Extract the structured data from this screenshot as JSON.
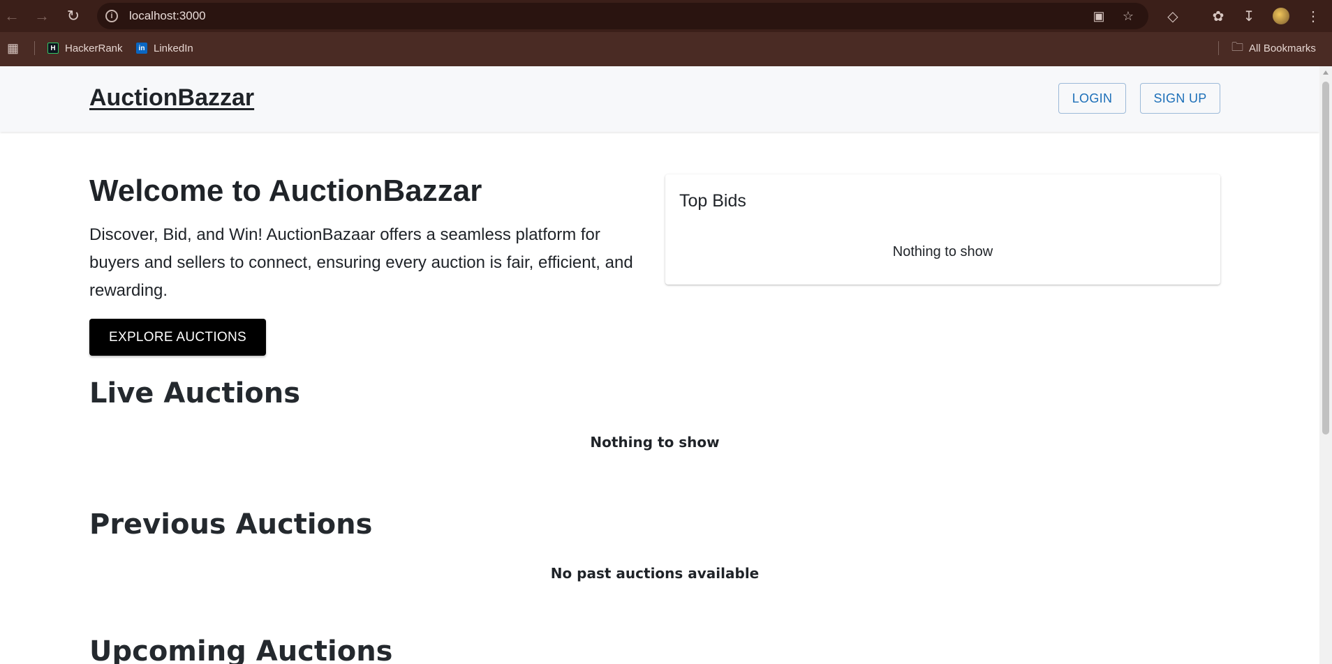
{
  "browser": {
    "url": "localhost:3000",
    "bookmarks": [
      {
        "label": "HackerRank",
        "icon": "hackerrank-icon"
      },
      {
        "label": "LinkedIn",
        "icon": "linkedin-icon"
      }
    ],
    "all_bookmarks_label": "All Bookmarks"
  },
  "header": {
    "brand": "AuctionBazzar",
    "login_label": "LOGIN",
    "signup_label": "SIGN UP"
  },
  "hero": {
    "title": "Welcome to AuctionBazzar",
    "description": "Discover, Bid, and Win! AuctionBazaar offers a seamless platform for buyers and sellers to connect, ensuring every auction is fair, efficient, and rewarding.",
    "cta_label": "EXPLORE AUCTIONS"
  },
  "top_bids": {
    "title": "Top Bids",
    "empty_text": "Nothing to show"
  },
  "sections": {
    "live": {
      "title": "Live Auctions",
      "empty_text": "Nothing to show"
    },
    "previous": {
      "title": "Previous Auctions",
      "empty_text": "No past auctions available"
    },
    "upcoming": {
      "title": "Upcoming Auctions"
    }
  },
  "colors": {
    "chrome": "#3b1f19",
    "accent": "#1c6fb8",
    "cta": "#000000"
  }
}
